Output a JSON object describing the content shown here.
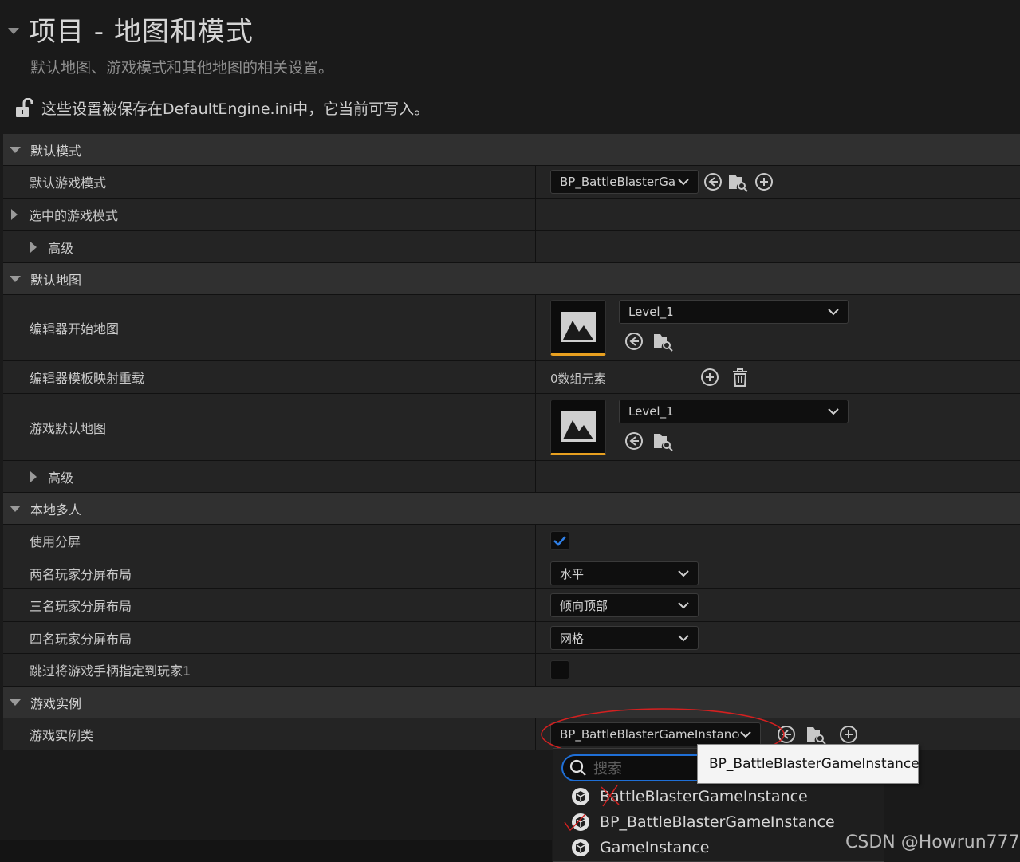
{
  "header": {
    "title": "项目 - 地图和模式",
    "subtitle": "默认地图、游戏模式和其他地图的相关设置。",
    "save_notice": "这些设置被保存在DefaultEngine.ini中，它当前可写入。"
  },
  "sections": {
    "default_modes": {
      "title": "默认模式",
      "default_game_mode_label": "默认游戏模式",
      "default_game_mode_value": "BP_BattleBlasterGa",
      "selected_game_mode_label": "选中的游戏模式",
      "advanced_label": "高级"
    },
    "default_maps": {
      "title": "默认地图",
      "editor_startup_map_label": "编辑器开始地图",
      "editor_startup_map_value": "Level_1",
      "editor_template_override_label": "编辑器模板映射重载",
      "editor_template_override_value": "0数组元素",
      "game_default_map_label": "游戏默认地图",
      "game_default_map_value": "Level_1",
      "advanced_label": "高级"
    },
    "local_multiplayer": {
      "title": "本地多人",
      "use_splitscreen_label": "使用分屏",
      "use_splitscreen_checked": true,
      "two_player_label": "两名玩家分屏布局",
      "two_player_value": "水平",
      "three_player_label": "三名玩家分屏布局",
      "three_player_value": "倾向顶部",
      "four_player_label": "四名玩家分屏布局",
      "four_player_value": "网格",
      "skip_gamepad_label": "跳过将游戏手柄指定到玩家1",
      "skip_gamepad_checked": false
    },
    "game_instance": {
      "title": "游戏实例",
      "game_instance_class_label": "游戏实例类",
      "game_instance_class_value": "BP_BattleBlasterGameInstance"
    }
  },
  "dropdown_popup": {
    "search_placeholder": "搜索",
    "options": [
      "BattleBlasterGameInstance",
      "BP_BattleBlasterGameInstance",
      "GameInstance"
    ],
    "tooltip": "BP_BattleBlasterGameInstance"
  },
  "watermark": "CSDN @Howrun777",
  "colors": {
    "accent_blue": "#1f6fd6",
    "thumbnail_accent": "#e8a020",
    "annotation_red": "#d42020"
  }
}
